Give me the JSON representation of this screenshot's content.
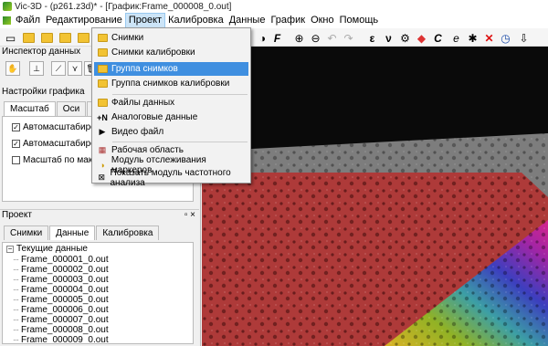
{
  "window": {
    "title": "Vic-3D - (p261.z3d)* - [График:Frame_000008_0.out]"
  },
  "menubar": {
    "items": [
      "Файл",
      "Редактирование",
      "Проект",
      "Калибровка",
      "Данные",
      "График",
      "Окно",
      "Помощь"
    ],
    "active": "Проект"
  },
  "dropdown": {
    "items": [
      {
        "label": "Снимки",
        "icon": "folder-icon"
      },
      {
        "label": "Снимки калибровки",
        "icon": "folder-icon"
      },
      {
        "label": "Группа снимков",
        "icon": "folder-icon",
        "highlighted": true
      },
      {
        "label": "Группа снимков калибровки",
        "icon": "folder-icon"
      },
      {
        "label": "Файлы данных",
        "icon": "folder-icon"
      },
      {
        "label": "Аналоговые данные",
        "icon": "analog-icon",
        "icon_text": "+N"
      },
      {
        "label": "Видео файл",
        "icon": "video-icon"
      },
      {
        "label": "Рабочая область",
        "icon": "workspace-icon"
      },
      {
        "label": "Модуль отслеживания маркеров",
        "icon": "marker-icon"
      },
      {
        "label": "Показать модуль частотного анализа",
        "icon": "frequency-icon"
      }
    ]
  },
  "toolbar": {
    "right_glyphs": [
      "ε",
      "ν",
      "C",
      "e",
      "✕"
    ]
  },
  "inspector": {
    "title": "Инспектор данных"
  },
  "graph_settings": {
    "title": "Настройки графика",
    "tabs": [
      "Масштаб",
      "Оси",
      "Ко"
    ],
    "options": [
      {
        "label": "Автомасштабирован",
        "checked": true
      },
      {
        "label": "Автомасштабирован",
        "checked": true
      },
      {
        "label": "Масштаб по максима",
        "checked": false
      }
    ]
  },
  "project": {
    "title": "Проект",
    "tabs": [
      "Снимки",
      "Данные",
      "Калибровка"
    ],
    "selected_tab": "Данные",
    "tree_root": "Текущие данные",
    "files": [
      "Frame_000001_0.out",
      "Frame_000002_0.out",
      "Frame_000003_0.out",
      "Frame_000004_0.out",
      "Frame_000005_0.out",
      "Frame_000006_0.out",
      "Frame_000007_0.out",
      "Frame_000008_0.out",
      "Frame_000009_0.out"
    ]
  },
  "colors": {
    "highlight": "#3f8fe0",
    "menu_bg": "#f2f2f2",
    "overlay_red": "#c0201f"
  }
}
